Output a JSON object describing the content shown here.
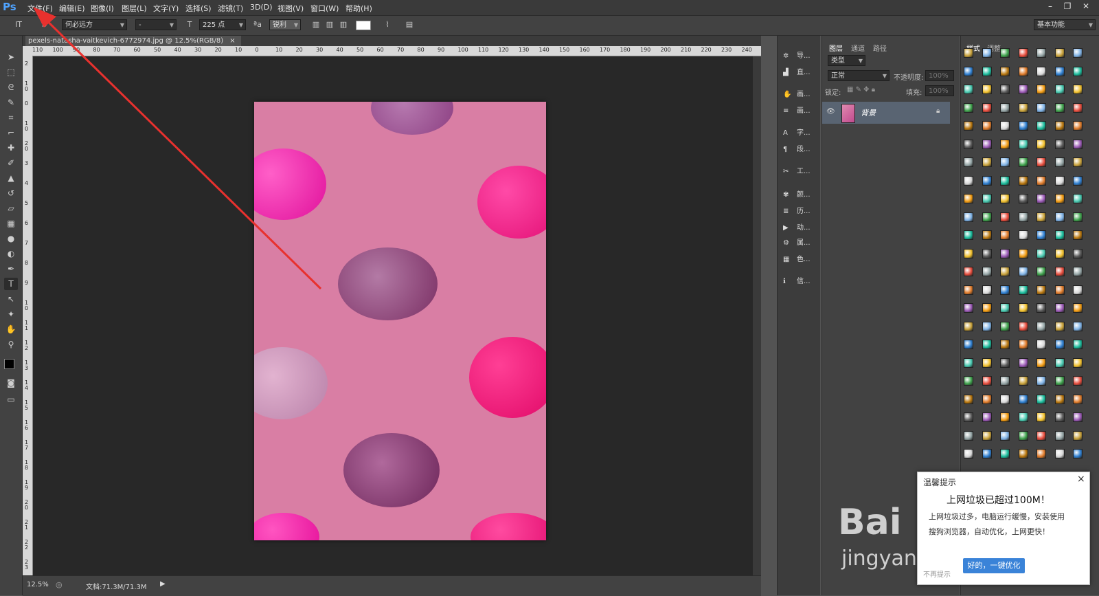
{
  "app": {
    "logo": "Ps"
  },
  "menu": [
    "文件(F)",
    "编辑(E)",
    "图像(I)",
    "图层(L)",
    "文字(Y)",
    "选择(S)",
    "滤镜(T)",
    "3D(D)",
    "视图(V)",
    "窗口(W)",
    "帮助(H)"
  ],
  "window_buttons": {
    "minimize": "–",
    "restore": "❐",
    "close": "✕"
  },
  "options": {
    "tool_glyph": "IT",
    "font_family": "何必远方",
    "font_style": "-",
    "font_size": "225 点",
    "aa_label": "ªa",
    "antialias": "锐利",
    "workspace": "基本功能"
  },
  "document": {
    "tab_title": "pexels-natasha-vaitkevich-6772974.jpg @ 12.5%(RGB/8)",
    "tab_close": "×",
    "zoom": "12.5%",
    "doc_size": "文档:71.3M/71.3M"
  },
  "ruler_h_labels": [
    "110",
    "100",
    "90",
    "80",
    "70",
    "60",
    "50",
    "40",
    "30",
    "20",
    "10",
    "0",
    "10",
    "20",
    "30",
    "40",
    "50",
    "60",
    "70",
    "80",
    "90",
    "100",
    "110",
    "120",
    "130",
    "140",
    "150",
    "160",
    "170",
    "180",
    "190",
    "200",
    "210",
    "220",
    "230",
    "240"
  ],
  "ruler_v_labels": [
    "2",
    "1 0",
    "0",
    "1 0",
    "2 0",
    "3",
    "4",
    "5",
    "6",
    "7",
    "8",
    "9",
    "1 0",
    "1 1",
    "1 2",
    "1 3",
    "1 4",
    "1 5",
    "1 6",
    "1 7",
    "1 8",
    "1 9",
    "2 0",
    "2 1",
    "2 2",
    "2 3"
  ],
  "dock_panels": [
    "导...",
    "直...",
    "画...",
    "画...",
    "字...",
    "段...",
    "工...",
    "颜...",
    "历...",
    "动...",
    "属...",
    "色...",
    "信..."
  ],
  "layers_panel": {
    "tabs": [
      "图层",
      "通道",
      "路径"
    ],
    "filter_kind": "类型",
    "blend_mode": "正常",
    "opacity_label": "不透明度:",
    "opacity_value": "100%",
    "lock_label": "锁定:",
    "fill_label": "填充:",
    "fill_value": "100%",
    "layers": [
      {
        "name": "背景",
        "visible": true,
        "locked": true
      }
    ]
  },
  "styles_panel": {
    "tabs": [
      "样式",
      "调整"
    ]
  },
  "popup": {
    "title": "温馨提示",
    "close": "×",
    "headline": "上网垃圾已超过100M！",
    "body_line1": "上网垃圾过多，电脑运行缓慢，安装使用",
    "body_line2": "搜狗浏览器，自动优化，上网更快！",
    "cta": "好的，一键优化",
    "dismiss": "不再提示"
  },
  "watermark": {
    "logo": "Bai",
    "url": "jingyan.baidu.com"
  },
  "colors": {
    "accent": "#3a83d8",
    "arrow": "#e8312e",
    "canvas": "#282828",
    "photo_bg": "#d97ea4"
  }
}
